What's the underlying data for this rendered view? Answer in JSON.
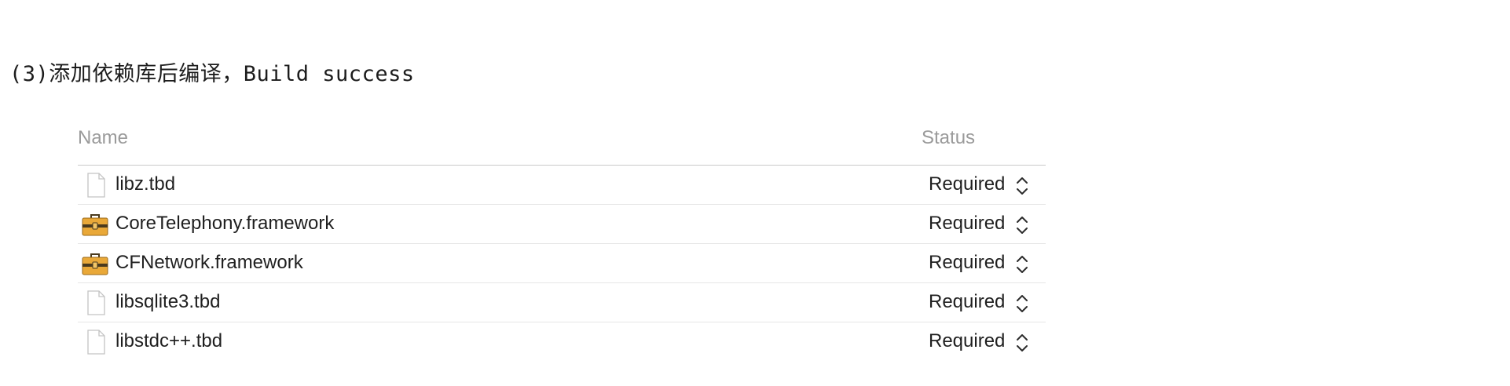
{
  "heading": "(3)添加依赖库后编译，Build success",
  "table": {
    "columns": {
      "name": "Name",
      "status": "Status"
    },
    "rows": [
      {
        "name": "libz.tbd",
        "status": "Required",
        "icon": "document-icon"
      },
      {
        "name": "CoreTelephony.framework",
        "status": "Required",
        "icon": "toolbox-icon"
      },
      {
        "name": "CFNetwork.framework",
        "status": "Required",
        "icon": "toolbox-icon"
      },
      {
        "name": "libsqlite3.tbd",
        "status": "Required",
        "icon": "document-icon"
      },
      {
        "name": "libstdc++.tbd",
        "status": "Required",
        "icon": "document-icon"
      }
    ]
  },
  "colors": {
    "header_text": "#9a9a9a",
    "row_text": "#1f1f1f",
    "toolbox_body": "#e9a838",
    "toolbox_band": "#4a3a1e",
    "divider": "#e6e6e6"
  }
}
